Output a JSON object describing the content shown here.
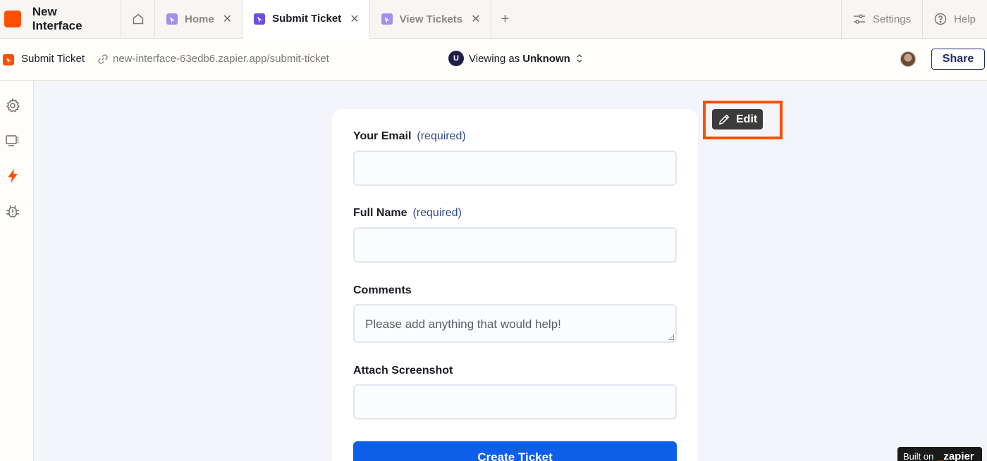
{
  "app": {
    "title": "New Interface",
    "brand_color": "#ff4f00"
  },
  "tabs": [
    {
      "label": "Home",
      "active": false
    },
    {
      "label": "Submit Ticket",
      "active": true
    },
    {
      "label": "View Tickets",
      "active": false
    }
  ],
  "tabbar_right": {
    "settings_label": "Settings",
    "help_label": "Help"
  },
  "address": {
    "page_name": "Submit Ticket",
    "url": "new-interface-63edb6.zapier.app/submit-ticket",
    "viewing_prefix": "Viewing as",
    "viewing_user": "Unknown",
    "viewing_initial": "U",
    "share_label": "Share"
  },
  "sidebar": {
    "icons": [
      "gear-icon",
      "monitor-icon",
      "lightning-icon",
      "bug-icon"
    ]
  },
  "form": {
    "email": {
      "label": "Your Email",
      "required_text": "(required)",
      "value": ""
    },
    "full_name": {
      "label": "Full Name",
      "required_text": "(required)",
      "value": ""
    },
    "comments": {
      "label": "Comments",
      "placeholder": "Please add anything that would help!"
    },
    "screenshot": {
      "label": "Attach Screenshot",
      "value": ""
    },
    "submit_label": "Create Ticket",
    "button_color": "#0d5ee8"
  },
  "edit": {
    "label": "Edit",
    "highlight_color": "#ff4f00"
  },
  "footer": {
    "built_on_prefix": "Built on",
    "built_on_brand": "zapier"
  }
}
